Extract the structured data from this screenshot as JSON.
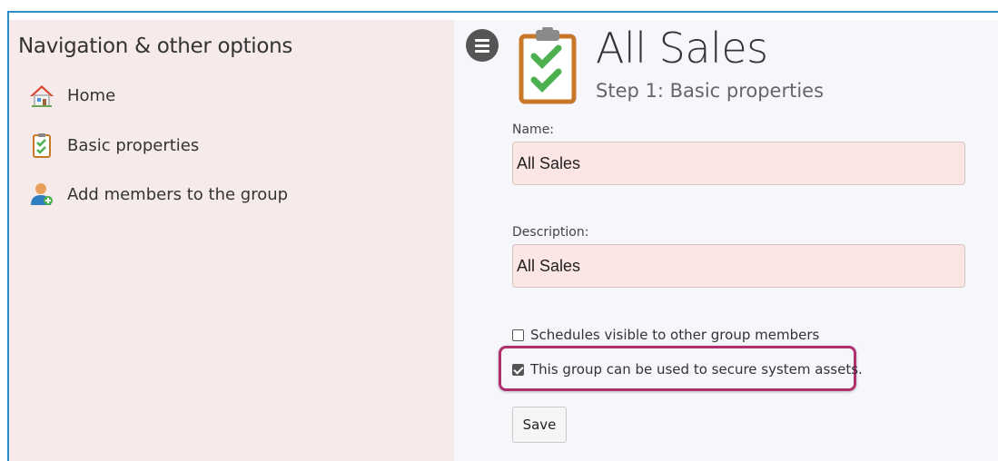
{
  "sidebar": {
    "title": "Navigation & other options",
    "items": [
      {
        "label": "Home",
        "icon": "home-icon"
      },
      {
        "label": "Basic properties",
        "icon": "clipboard-check-icon"
      },
      {
        "label": "Add members to the group",
        "icon": "user-add-icon"
      }
    ]
  },
  "header": {
    "title": "All Sales",
    "subtitle": "Step 1: Basic properties",
    "menu_icon": "hamburger-menu-icon",
    "page_icon": "clipboard-check-icon"
  },
  "form": {
    "name_label": "Name:",
    "name_value": "All Sales",
    "description_label": "Description:",
    "description_value": "All Sales",
    "checkbox_schedules": {
      "label": "Schedules visible to other group members",
      "checked": false
    },
    "checkbox_secure": {
      "label": "This group can be used to secure system assets.",
      "checked": true
    },
    "save_label": "Save"
  },
  "colors": {
    "frame_border": "#2a8fc7",
    "sidebar_bg": "#f6eaea",
    "input_bg": "#fce6e3",
    "highlight": "#b0306f"
  }
}
